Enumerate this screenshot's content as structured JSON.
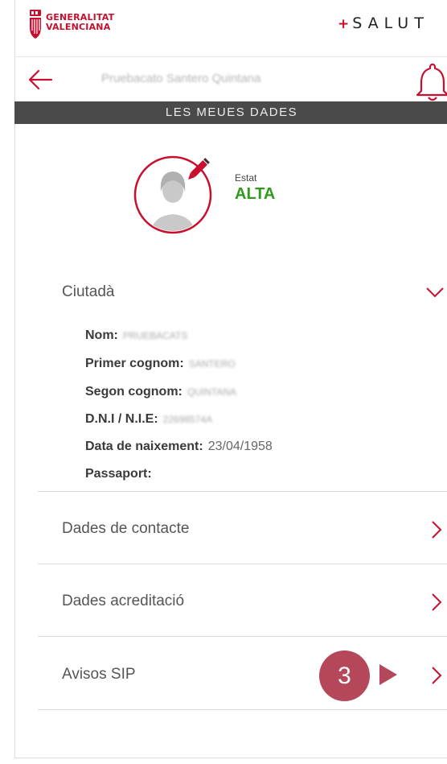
{
  "header": {
    "org_line1": "GENERALITAT",
    "org_line2": "VALENCIANA",
    "brand_plus": "+",
    "brand_name": "SALUT",
    "user_name": "Pruebacato Santero Quintana",
    "back_icon": "arrow-left-icon",
    "bell_icon": "bell-icon"
  },
  "page_title": "LES MEUES DADES",
  "profile": {
    "status_caption": "Estat",
    "status_value": "ALTA",
    "avatar_icon": "user-avatar-edit-icon"
  },
  "sections": {
    "ciutada": {
      "title": "Ciutadà",
      "expanded": true,
      "fields": [
        {
          "label": "Nom:",
          "value": "PRUEBACATS"
        },
        {
          "label": "Primer cognom:",
          "value": "SANTERO"
        },
        {
          "label": "Segon cognom:",
          "value": "QUINTANA"
        },
        {
          "label": "D.N.I / N.I.E:",
          "value": "22698574A"
        },
        {
          "label": "Data de naixement:",
          "value": "23/04/1958"
        },
        {
          "label": "Passaport:",
          "value": ""
        }
      ]
    },
    "contacte": {
      "title": "Dades de contacte"
    },
    "acreditacio": {
      "title": "Dades acreditació"
    },
    "avisos": {
      "title": "Avisos SIP"
    }
  },
  "annotation": {
    "step": "3"
  },
  "colors": {
    "brand_red": "#c8102e",
    "title_bar": "#4a4a4a",
    "status_green": "#2f9a1d",
    "marker": "#b4475a"
  }
}
